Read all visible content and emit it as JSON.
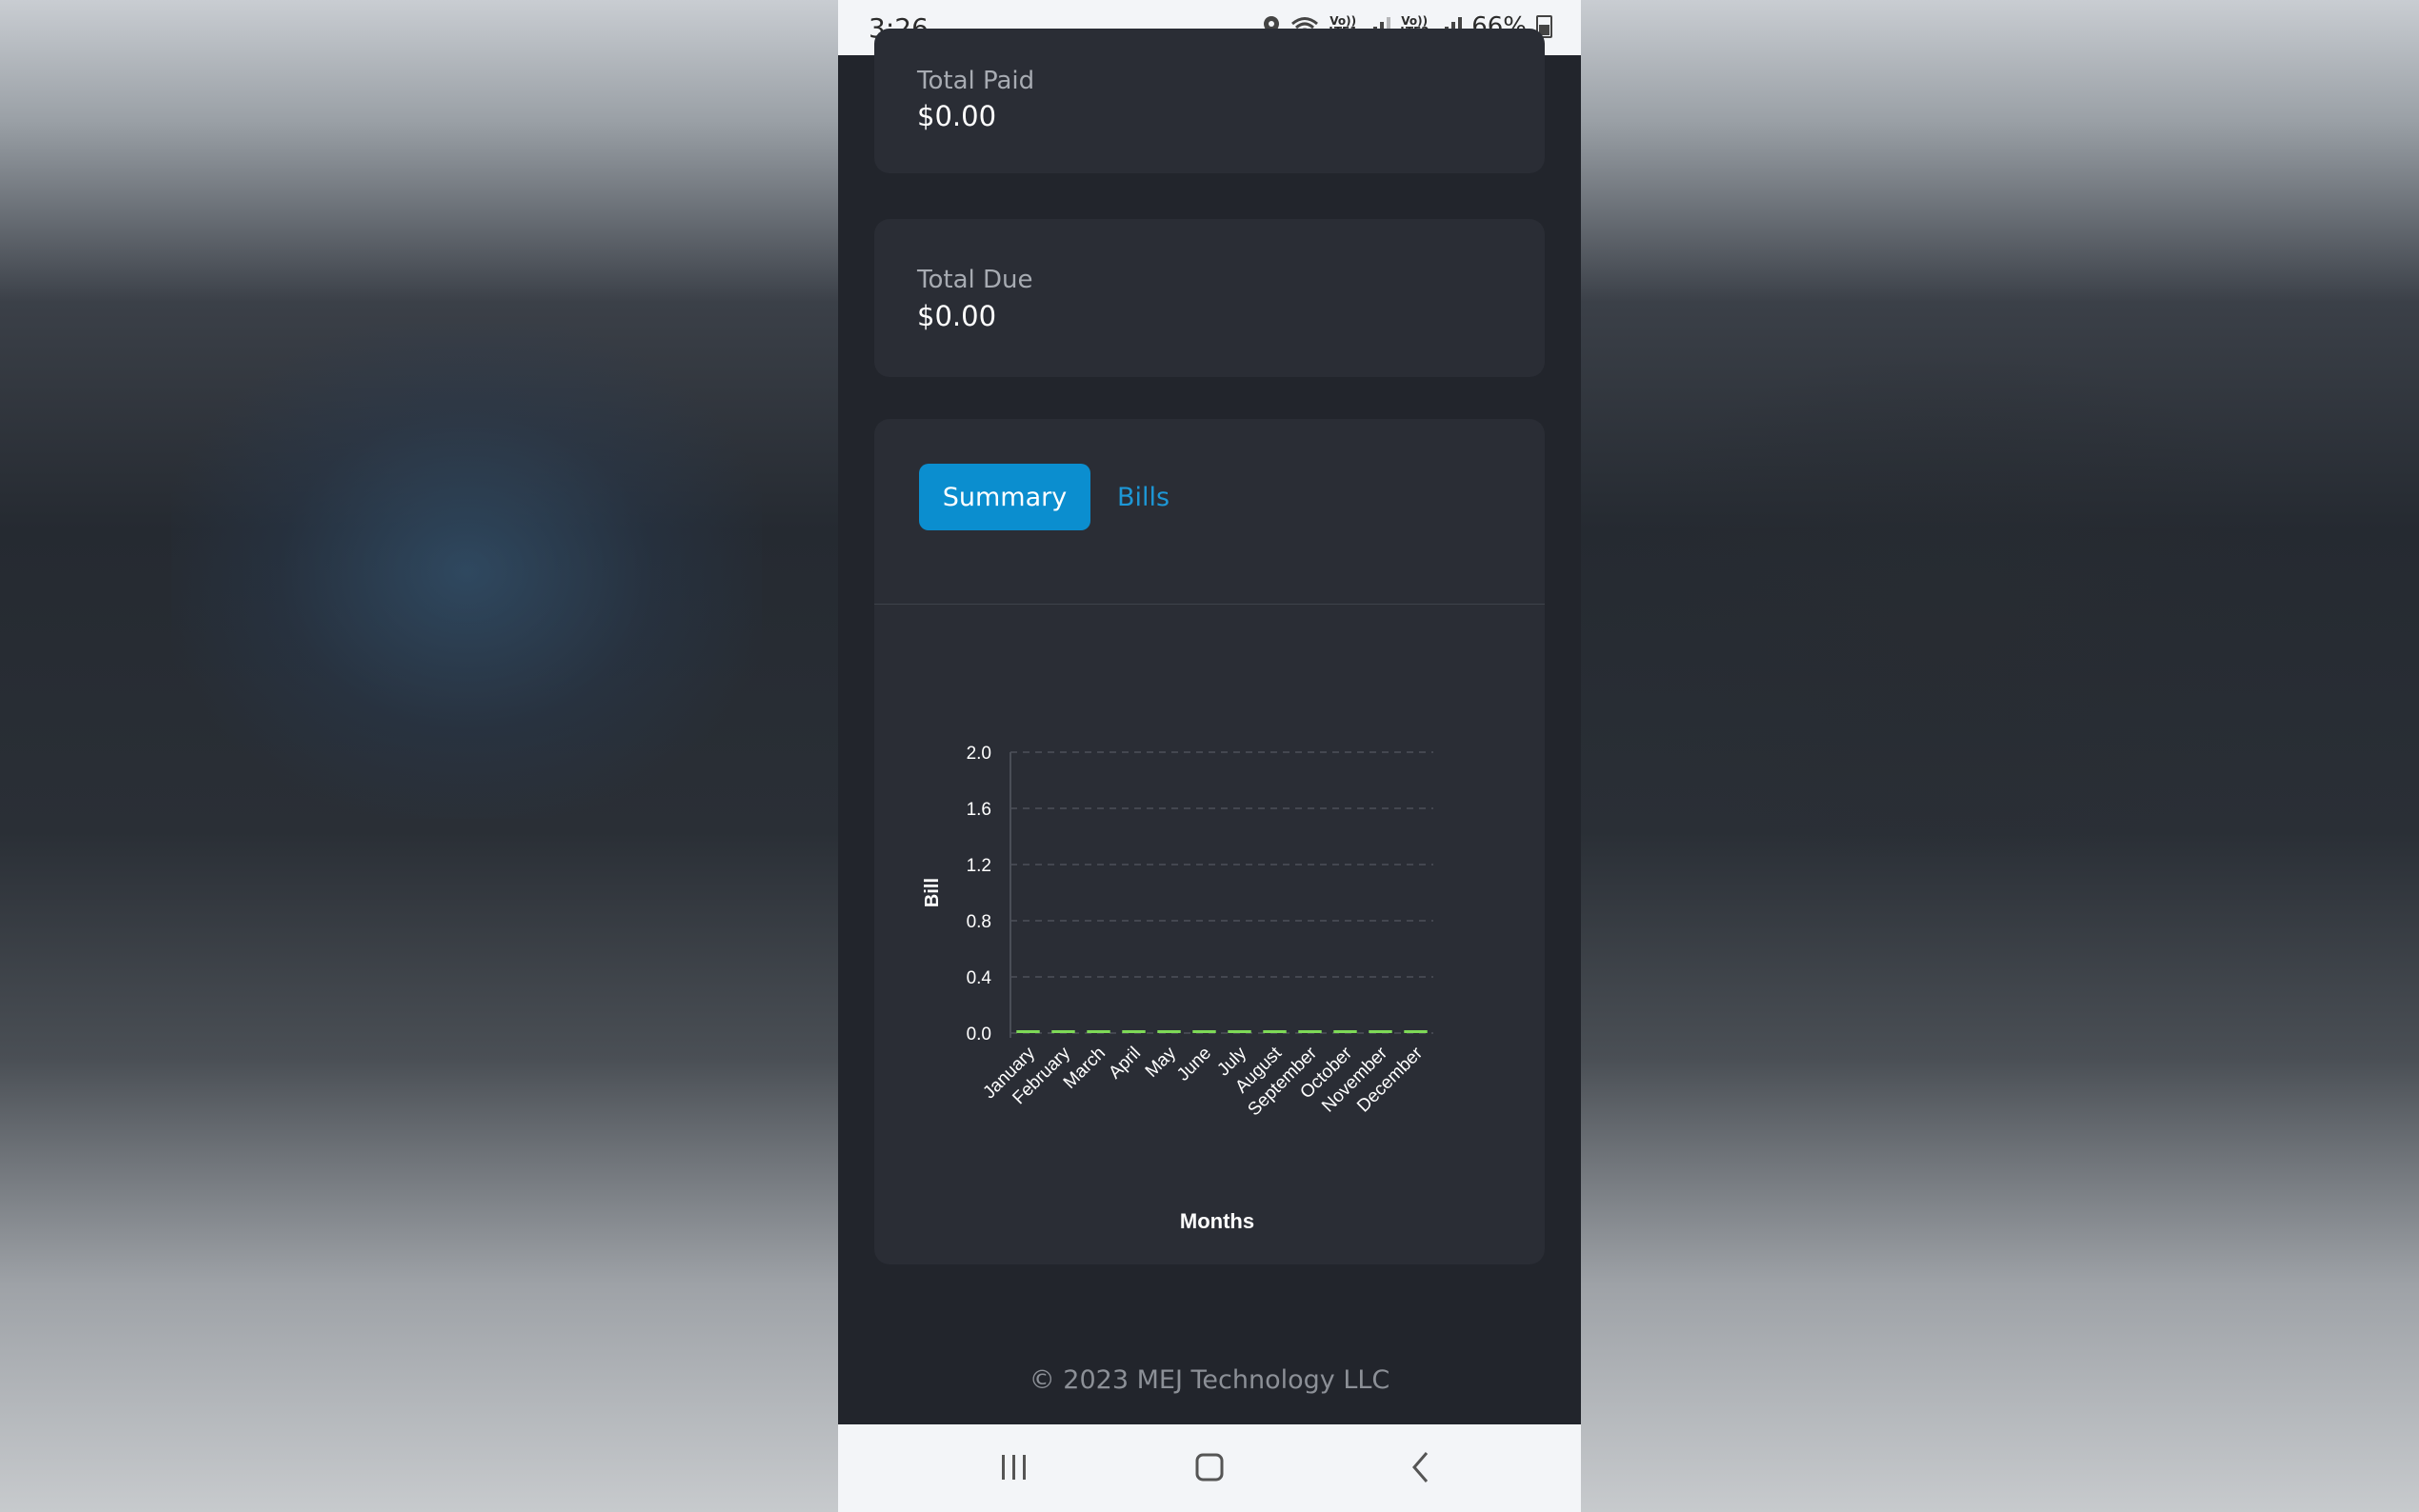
{
  "status_bar": {
    "time": "3:26",
    "lte1": "Vo)) LTE1",
    "lte2": "Vo)) LTE2",
    "battery": "66%"
  },
  "cards": {
    "total_paid": {
      "label": "Total Paid",
      "value": "$0.00"
    },
    "total_due": {
      "label": "Total Due",
      "value": "$0.00"
    }
  },
  "tabs": {
    "summary": "Summary",
    "bills": "Bills"
  },
  "chart_data": {
    "type": "bar",
    "categories": [
      "January",
      "February",
      "March",
      "April",
      "May",
      "June",
      "July",
      "August",
      "September",
      "October",
      "November",
      "December"
    ],
    "values": [
      0,
      0,
      0,
      0,
      0,
      0,
      0,
      0,
      0,
      0,
      0,
      0
    ],
    "xlabel": "Months",
    "ylabel": "Bill",
    "ylim": [
      0,
      2.0
    ],
    "yticks": [
      "0.0",
      "0.4",
      "0.8",
      "1.2",
      "1.6",
      "2.0"
    ],
    "grid": true,
    "bar_color": "#7ed957"
  },
  "footer": {
    "text": "© 2023 MEJ Technology LLC"
  },
  "colors": {
    "accent": "#0b8ecf",
    "bar": "#7ed957",
    "background": "#22252c",
    "card": "#2a2d35"
  }
}
